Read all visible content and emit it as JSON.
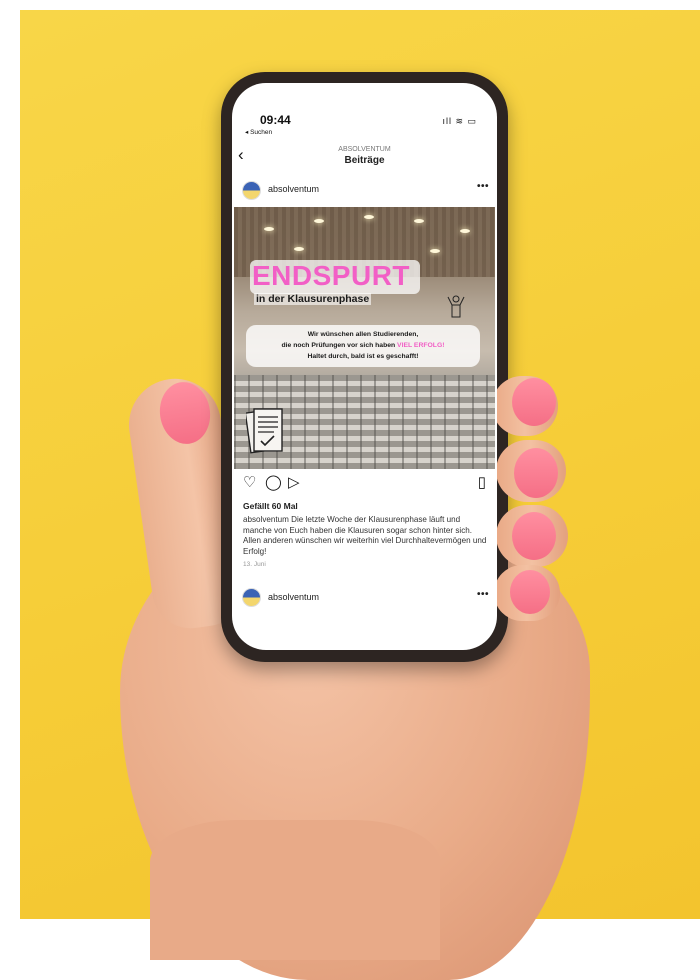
{
  "status_bar": {
    "time": "09:44",
    "back_label": "◂ Suchen",
    "icons": "ıll ≋ ▭"
  },
  "nav": {
    "account": "ABSOLVENTUM",
    "title": "Beiträge",
    "back_icon": "chevron-left-icon"
  },
  "post": {
    "username": "absolventum",
    "more": "•••",
    "image": {
      "headline": "ENDSPURT",
      "subheadline": "in der Klausurenphase",
      "message_line_1": "Wir wünschen allen Studierenden,",
      "message_line_2_start": "die noch Prüfungen vor sich haben ",
      "message_line_2_highlight": "VIEL ERFOLG!",
      "message_line_3": "Haltet durch, bald ist es geschafft!",
      "highlight_color": "#f25fc6"
    },
    "actions": {
      "like_icon": "heart-icon",
      "comment_icon": "comment-icon",
      "share_icon": "send-icon",
      "save_icon": "bookmark-icon"
    },
    "likes": "Gefällt 60 Mal",
    "caption_user": "absolventum",
    "caption_text": "Die letzte Woche der Klausurenphase läuft und manche von Euch haben die Klausuren sogar schon hinter sich. Allen anderen wünschen wir weiterhin viel Durchhaltevermögen und Erfolg!",
    "date": "13. Juni"
  },
  "next_post": {
    "username": "absolventum",
    "more": "•••"
  },
  "colors": {
    "background": "#f6cd38",
    "phone_frame": "#2d2522",
    "nail": "#f56f86"
  }
}
